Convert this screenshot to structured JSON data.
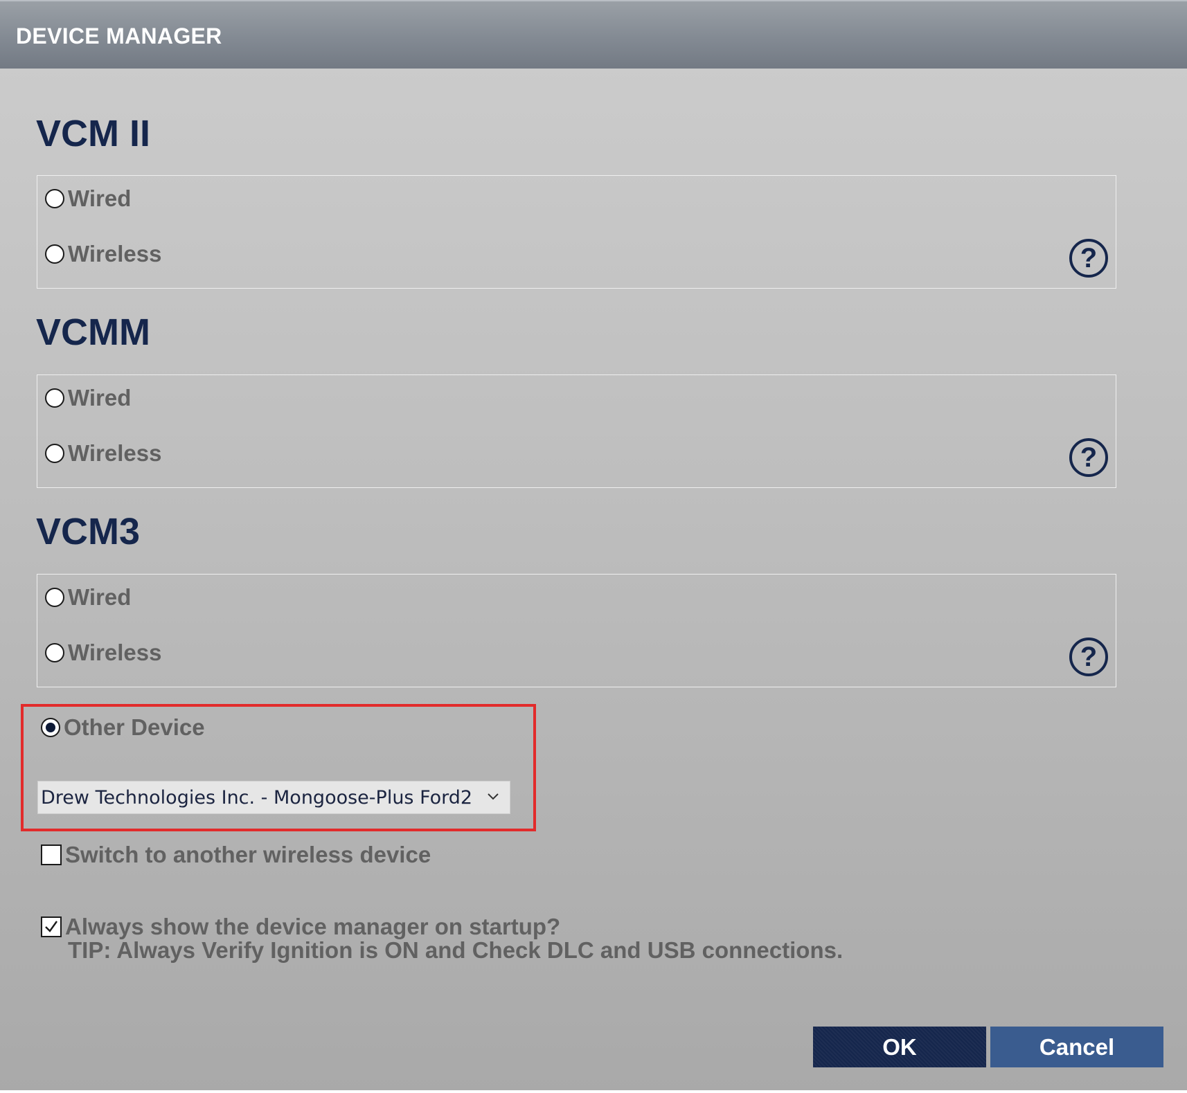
{
  "window": {
    "title": "DEVICE MANAGER"
  },
  "sections": [
    {
      "title": "VCM II",
      "options": [
        "Wired",
        "Wireless"
      ],
      "help_icon": "question-mark-icon"
    },
    {
      "title": "VCMM",
      "options": [
        "Wired",
        "Wireless"
      ],
      "help_icon": "question-mark-icon"
    },
    {
      "title": "VCM3",
      "options": [
        "Wired",
        "Wireless"
      ],
      "help_icon": "question-mark-icon"
    }
  ],
  "other_device": {
    "label": "Other Device",
    "selected": true,
    "dropdown_value": "Drew Technologies Inc. - Mongoose-Plus Ford2"
  },
  "switch_wireless": {
    "label": "Switch to another wireless device",
    "checked": false
  },
  "always_show": {
    "label": "Always show the device manager on startup?",
    "checked": true
  },
  "tip": "TIP: Always Verify Ignition is ON and Check DLC and USB connections.",
  "buttons": {
    "ok": "OK",
    "cancel": "Cancel"
  },
  "colors": {
    "title_text": "#ffffff",
    "section_title": "#15264c",
    "option_text": "#616161",
    "highlight_border": "#e22b2b",
    "ok_button": "#15264c",
    "cancel_button": "#3a5c8f"
  }
}
